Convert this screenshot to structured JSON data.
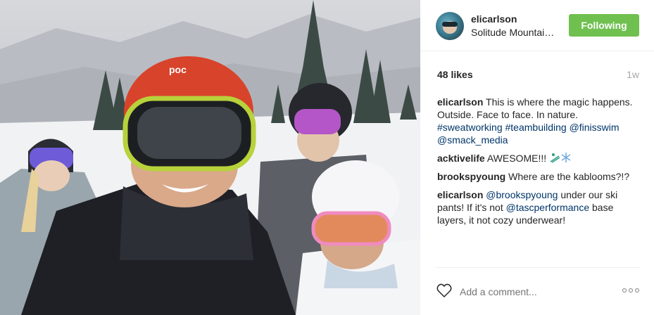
{
  "post": {
    "username": "elicarlson",
    "location": "Solitude Mountain Resort",
    "follow_label": "Following",
    "likes": "48 likes",
    "time": "1w",
    "helmet_brand": "poc"
  },
  "comments": [
    {
      "user": "elicarlson",
      "segments": [
        {
          "text": "This is where the magic happens. Outside. Face to face. In nature. "
        },
        {
          "text": "#sweatworking",
          "tag": true
        },
        {
          "text": " "
        },
        {
          "text": "#teambuilding",
          "tag": true
        },
        {
          "text": " "
        },
        {
          "text": "@finisswim",
          "tag": true
        },
        {
          "text": " "
        },
        {
          "text": "@smack_media",
          "tag": true
        }
      ]
    },
    {
      "user": "acktivelife",
      "segments": [
        {
          "text": "AWESOME!!! "
        }
      ],
      "emojis": [
        "skier-emoji",
        "snowflake-emoji"
      ]
    },
    {
      "user": "brookspyoung",
      "segments": [
        {
          "text": "Where are the kablooms?!?"
        }
      ]
    },
    {
      "user": "elicarlson",
      "segments": [
        {
          "text": "@brookspyoung",
          "tag": true
        },
        {
          "text": " under our ski pants! If it's not "
        },
        {
          "text": "@tascperformance",
          "tag": true
        },
        {
          "text": " base layers, it not cozy underwear!"
        }
      ]
    }
  ],
  "footer": {
    "placeholder": "Add a comment...",
    "like_icon": "heart-icon",
    "more_icon": "more-options-icon"
  },
  "colors": {
    "follow": "#70c050",
    "tag": "#003569",
    "muted": "#a5a7aa"
  }
}
